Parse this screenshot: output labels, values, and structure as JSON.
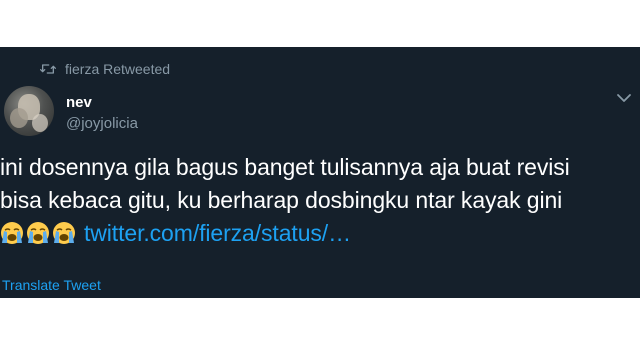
{
  "retweet": {
    "text": "fierza Retweeted",
    "icon": "retweet-icon"
  },
  "author": {
    "display_name": "nev",
    "handle": "@joyjolicia"
  },
  "menu": {
    "icon": "chevron-down-icon"
  },
  "tweet": {
    "line1": "ini dosennya gila bagus banget tulisannya aja buat revisi",
    "line2": "bisa kebaca gitu, ku berharap dosbingku ntar kayak gini",
    "emoji": [
      "loudly-crying-face-icon",
      "loudly-crying-face-icon",
      "loudly-crying-face-icon"
    ],
    "link_text": "twitter.com/fierza/status/…"
  },
  "translate_label": "Translate Tweet",
  "colors": {
    "background": "#15202b",
    "secondary_text": "#8899a6",
    "link": "#1da1f2"
  }
}
